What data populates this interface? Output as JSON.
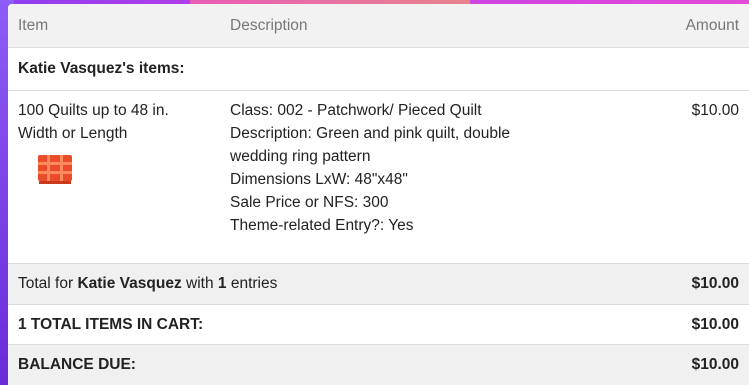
{
  "header": {
    "item": "Item",
    "description": "Description",
    "amount": "Amount"
  },
  "section_title": "Katie Vasquez's items:",
  "item": {
    "name_line1": "100 Quilts up to 48 in.",
    "name_line2": "Width or Length",
    "icon": "quilt-icon",
    "details": [
      "Class: 002 - Patchwork/ Pieced Quilt",
      "Description: Green and pink quilt, double",
      "wedding ring pattern",
      "Dimensions LxW: 48\"x48\"",
      "Sale Price or NFS: 300",
      "Theme-related Entry?: Yes"
    ],
    "amount": "$10.00"
  },
  "total_row": {
    "prefix": "Total for",
    "name": "Katie Vasquez",
    "mid": "with",
    "count": "1",
    "suffix": "entries",
    "amount": "$10.00"
  },
  "cart_total": {
    "label": "1 TOTAL ITEMS IN CART:",
    "amount": "$10.00"
  },
  "balance": {
    "label": "BALANCE DUE:",
    "amount": "$10.00"
  },
  "colors": {
    "background_left": "#8f3cf0",
    "background_right": "#e24ad8",
    "icon": "#e94b2b"
  }
}
